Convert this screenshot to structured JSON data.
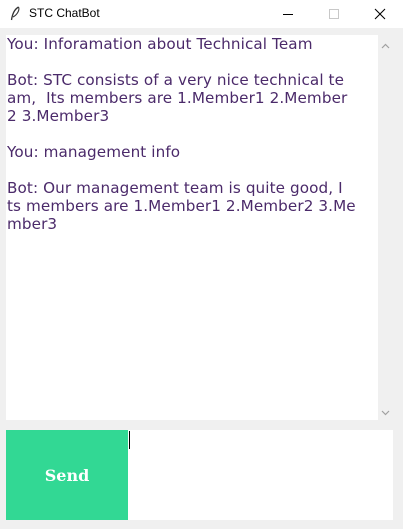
{
  "window": {
    "title": "STC ChatBot",
    "icons": {
      "app": "feather-icon",
      "minimize": "minimize-icon",
      "maximize": "maximize-icon",
      "close": "close-icon"
    }
  },
  "chat": {
    "lines": [
      "You: Inforamation about Technical Team",
      "",
      "Bot: STC consists of a very nice technical te",
      "am,  Its members are 1.Member1 2.Member",
      "2 3.Member3",
      "",
      "You: management info",
      "",
      "Bot: Our management team is quite good, I",
      "ts members are 1.Member1 2.Member2 3.Me",
      "mber3"
    ],
    "text_color": "#4b2a6a"
  },
  "send": {
    "label": "Send",
    "color": "#32d894"
  },
  "input": {
    "value": ""
  }
}
